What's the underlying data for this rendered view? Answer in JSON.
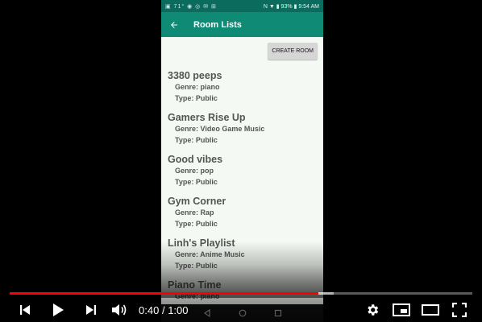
{
  "video": {
    "current_time": "0:40",
    "separator": "/",
    "duration": "1:00",
    "played_fraction": 0.667,
    "loaded_fraction": 0.7,
    "colors": {
      "played": "#ff0000"
    }
  },
  "phone": {
    "status": {
      "left_icons": "▣ 71° ◉ ◎ ✉ ⊞",
      "right": "N ▼ ▮ 93% ▮ 9:54 AM"
    },
    "appbar": {
      "title": "Room Lists"
    },
    "create_button": "CREATE ROOM",
    "rooms": [
      {
        "name": "3380 peeps",
        "genre": "Genre: piano",
        "type": "Type: Public"
      },
      {
        "name": "Gamers Rise Up",
        "genre": "Genre: Video Game Music",
        "type": "Type: Public"
      },
      {
        "name": "Good vibes",
        "genre": "Genre: pop",
        "type": "Type: Public"
      },
      {
        "name": "Gym Corner",
        "genre": "Genre: Rap",
        "type": "Type: Public"
      },
      {
        "name": "Linh's Playlist",
        "genre": "Genre: Anime Music",
        "type": "Type: Public"
      },
      {
        "name": "Piano Time",
        "genre": "Genre: piano",
        "type": ""
      }
    ],
    "colors": {
      "statusbar": "#0b6b5c",
      "appbar": "#0e8a75",
      "background": "#f4f9f3"
    }
  },
  "icons": {
    "prev": "skip-previous-icon",
    "play": "play-icon",
    "next": "skip-next-icon",
    "volume": "volume-icon",
    "settings": "gear-icon",
    "miniplayer": "miniplayer-icon",
    "theater": "theater-mode-icon",
    "fullscreen": "fullscreen-icon"
  }
}
